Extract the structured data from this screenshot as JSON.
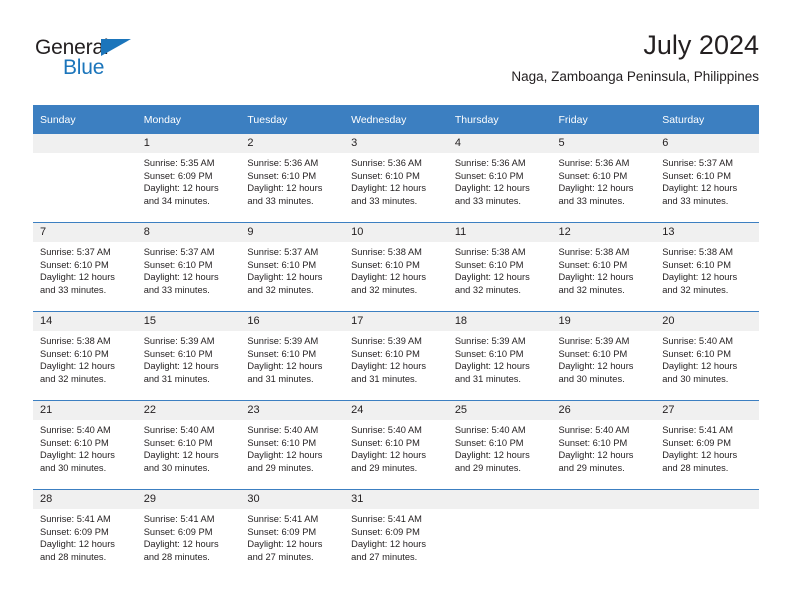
{
  "brand": {
    "name_dark": "General",
    "name_blue": "Blue",
    "triangle_icon": "triangle-icon",
    "accent_color": "#1b75bb"
  },
  "header": {
    "title": "July 2024",
    "subtitle": "Naga, Zamboanga Peninsula, Philippines"
  },
  "calendar": {
    "header_bg": "#3c7fc1",
    "daynum_bg": "#f0f0f0",
    "weekday_headers": [
      "Sunday",
      "Monday",
      "Tuesday",
      "Wednesday",
      "Thursday",
      "Friday",
      "Saturday"
    ],
    "weeks": [
      [
        {
          "day": "",
          "sunrise": "",
          "sunset": "",
          "daylight1": "",
          "daylight2": ""
        },
        {
          "day": "1",
          "sunrise": "Sunrise: 5:35 AM",
          "sunset": "Sunset: 6:09 PM",
          "daylight1": "Daylight: 12 hours",
          "daylight2": "and 34 minutes."
        },
        {
          "day": "2",
          "sunrise": "Sunrise: 5:36 AM",
          "sunset": "Sunset: 6:10 PM",
          "daylight1": "Daylight: 12 hours",
          "daylight2": "and 33 minutes."
        },
        {
          "day": "3",
          "sunrise": "Sunrise: 5:36 AM",
          "sunset": "Sunset: 6:10 PM",
          "daylight1": "Daylight: 12 hours",
          "daylight2": "and 33 minutes."
        },
        {
          "day": "4",
          "sunrise": "Sunrise: 5:36 AM",
          "sunset": "Sunset: 6:10 PM",
          "daylight1": "Daylight: 12 hours",
          "daylight2": "and 33 minutes."
        },
        {
          "day": "5",
          "sunrise": "Sunrise: 5:36 AM",
          "sunset": "Sunset: 6:10 PM",
          "daylight1": "Daylight: 12 hours",
          "daylight2": "and 33 minutes."
        },
        {
          "day": "6",
          "sunrise": "Sunrise: 5:37 AM",
          "sunset": "Sunset: 6:10 PM",
          "daylight1": "Daylight: 12 hours",
          "daylight2": "and 33 minutes."
        }
      ],
      [
        {
          "day": "7",
          "sunrise": "Sunrise: 5:37 AM",
          "sunset": "Sunset: 6:10 PM",
          "daylight1": "Daylight: 12 hours",
          "daylight2": "and 33 minutes."
        },
        {
          "day": "8",
          "sunrise": "Sunrise: 5:37 AM",
          "sunset": "Sunset: 6:10 PM",
          "daylight1": "Daylight: 12 hours",
          "daylight2": "and 33 minutes."
        },
        {
          "day": "9",
          "sunrise": "Sunrise: 5:37 AM",
          "sunset": "Sunset: 6:10 PM",
          "daylight1": "Daylight: 12 hours",
          "daylight2": "and 32 minutes."
        },
        {
          "day": "10",
          "sunrise": "Sunrise: 5:38 AM",
          "sunset": "Sunset: 6:10 PM",
          "daylight1": "Daylight: 12 hours",
          "daylight2": "and 32 minutes."
        },
        {
          "day": "11",
          "sunrise": "Sunrise: 5:38 AM",
          "sunset": "Sunset: 6:10 PM",
          "daylight1": "Daylight: 12 hours",
          "daylight2": "and 32 minutes."
        },
        {
          "day": "12",
          "sunrise": "Sunrise: 5:38 AM",
          "sunset": "Sunset: 6:10 PM",
          "daylight1": "Daylight: 12 hours",
          "daylight2": "and 32 minutes."
        },
        {
          "day": "13",
          "sunrise": "Sunrise: 5:38 AM",
          "sunset": "Sunset: 6:10 PM",
          "daylight1": "Daylight: 12 hours",
          "daylight2": "and 32 minutes."
        }
      ],
      [
        {
          "day": "14",
          "sunrise": "Sunrise: 5:38 AM",
          "sunset": "Sunset: 6:10 PM",
          "daylight1": "Daylight: 12 hours",
          "daylight2": "and 32 minutes."
        },
        {
          "day": "15",
          "sunrise": "Sunrise: 5:39 AM",
          "sunset": "Sunset: 6:10 PM",
          "daylight1": "Daylight: 12 hours",
          "daylight2": "and 31 minutes."
        },
        {
          "day": "16",
          "sunrise": "Sunrise: 5:39 AM",
          "sunset": "Sunset: 6:10 PM",
          "daylight1": "Daylight: 12 hours",
          "daylight2": "and 31 minutes."
        },
        {
          "day": "17",
          "sunrise": "Sunrise: 5:39 AM",
          "sunset": "Sunset: 6:10 PM",
          "daylight1": "Daylight: 12 hours",
          "daylight2": "and 31 minutes."
        },
        {
          "day": "18",
          "sunrise": "Sunrise: 5:39 AM",
          "sunset": "Sunset: 6:10 PM",
          "daylight1": "Daylight: 12 hours",
          "daylight2": "and 31 minutes."
        },
        {
          "day": "19",
          "sunrise": "Sunrise: 5:39 AM",
          "sunset": "Sunset: 6:10 PM",
          "daylight1": "Daylight: 12 hours",
          "daylight2": "and 30 minutes."
        },
        {
          "day": "20",
          "sunrise": "Sunrise: 5:40 AM",
          "sunset": "Sunset: 6:10 PM",
          "daylight1": "Daylight: 12 hours",
          "daylight2": "and 30 minutes."
        }
      ],
      [
        {
          "day": "21",
          "sunrise": "Sunrise: 5:40 AM",
          "sunset": "Sunset: 6:10 PM",
          "daylight1": "Daylight: 12 hours",
          "daylight2": "and 30 minutes."
        },
        {
          "day": "22",
          "sunrise": "Sunrise: 5:40 AM",
          "sunset": "Sunset: 6:10 PM",
          "daylight1": "Daylight: 12 hours",
          "daylight2": "and 30 minutes."
        },
        {
          "day": "23",
          "sunrise": "Sunrise: 5:40 AM",
          "sunset": "Sunset: 6:10 PM",
          "daylight1": "Daylight: 12 hours",
          "daylight2": "and 29 minutes."
        },
        {
          "day": "24",
          "sunrise": "Sunrise: 5:40 AM",
          "sunset": "Sunset: 6:10 PM",
          "daylight1": "Daylight: 12 hours",
          "daylight2": "and 29 minutes."
        },
        {
          "day": "25",
          "sunrise": "Sunrise: 5:40 AM",
          "sunset": "Sunset: 6:10 PM",
          "daylight1": "Daylight: 12 hours",
          "daylight2": "and 29 minutes."
        },
        {
          "day": "26",
          "sunrise": "Sunrise: 5:40 AM",
          "sunset": "Sunset: 6:10 PM",
          "daylight1": "Daylight: 12 hours",
          "daylight2": "and 29 minutes."
        },
        {
          "day": "27",
          "sunrise": "Sunrise: 5:41 AM",
          "sunset": "Sunset: 6:09 PM",
          "daylight1": "Daylight: 12 hours",
          "daylight2": "and 28 minutes."
        }
      ],
      [
        {
          "day": "28",
          "sunrise": "Sunrise: 5:41 AM",
          "sunset": "Sunset: 6:09 PM",
          "daylight1": "Daylight: 12 hours",
          "daylight2": "and 28 minutes."
        },
        {
          "day": "29",
          "sunrise": "Sunrise: 5:41 AM",
          "sunset": "Sunset: 6:09 PM",
          "daylight1": "Daylight: 12 hours",
          "daylight2": "and 28 minutes."
        },
        {
          "day": "30",
          "sunrise": "Sunrise: 5:41 AM",
          "sunset": "Sunset: 6:09 PM",
          "daylight1": "Daylight: 12 hours",
          "daylight2": "and 27 minutes."
        },
        {
          "day": "31",
          "sunrise": "Sunrise: 5:41 AM",
          "sunset": "Sunset: 6:09 PM",
          "daylight1": "Daylight: 12 hours",
          "daylight2": "and 27 minutes."
        },
        {
          "day": "",
          "sunrise": "",
          "sunset": "",
          "daylight1": "",
          "daylight2": ""
        },
        {
          "day": "",
          "sunrise": "",
          "sunset": "",
          "daylight1": "",
          "daylight2": ""
        },
        {
          "day": "",
          "sunrise": "",
          "sunset": "",
          "daylight1": "",
          "daylight2": ""
        }
      ]
    ]
  }
}
